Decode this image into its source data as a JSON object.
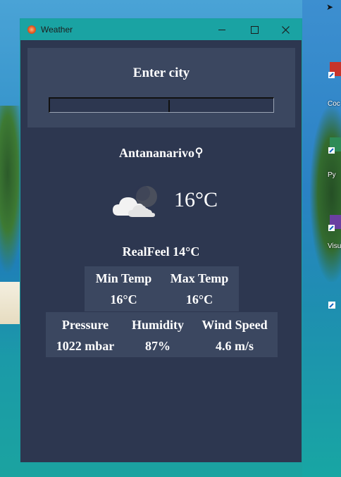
{
  "window": {
    "title": "Weather"
  },
  "search": {
    "heading": "Enter city",
    "value": "",
    "placeholder": ""
  },
  "weather": {
    "city": "Antananarivo",
    "condition_icon": "partly-cloudy-night-icon",
    "temperature": "16°C",
    "realfeel": "RealFeel 14°C"
  },
  "minmax": {
    "min_label": "Min Temp",
    "min_value": "16°C",
    "max_label": "Max Temp",
    "max_value": "16°C"
  },
  "stats": {
    "pressure_label": "Pressure",
    "pressure_value": "1022 mbar",
    "humidity_label": "Humidity",
    "humidity_value": "87%",
    "wind_label": "Wind Speed",
    "wind_value": "4.6 m/s"
  },
  "desktop": {
    "icon_labels": [
      "Coc",
      "Py",
      "Visu"
    ]
  },
  "colors": {
    "titlebar": "#1aa3a3",
    "window_bg": "#2d3750",
    "panel_bg": "#3b4760",
    "text": "#ffffff"
  }
}
